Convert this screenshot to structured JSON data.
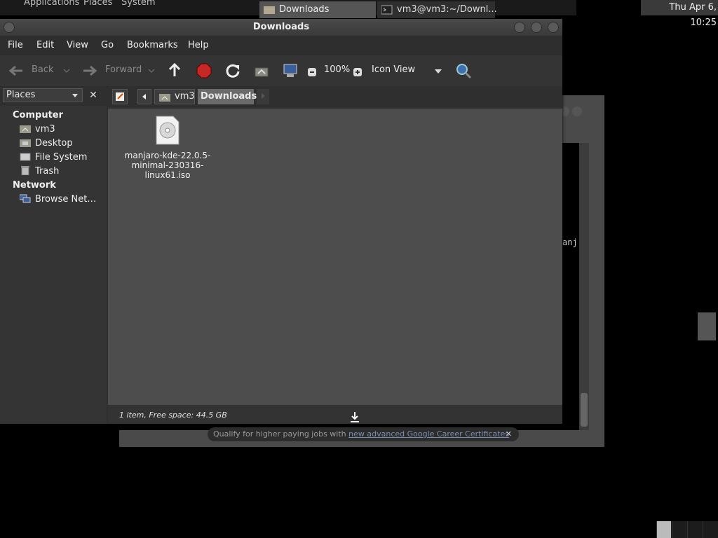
{
  "top_panel": {
    "menus": [
      "Applications",
      "Places",
      "System"
    ],
    "clock": "Thu Apr  6, 10:25"
  },
  "background_terminal": {
    "partial_text": "anj",
    "notification": {
      "text": "Qualify for higher paying jobs with ",
      "link": "new advanced Google Career Certificates",
      "close": "✕"
    }
  },
  "window": {
    "title": "Downloads",
    "menu": [
      "File",
      "Edit",
      "View",
      "Go",
      "Bookmarks",
      "Help"
    ],
    "toolbar": {
      "back": "Back",
      "forward": "Forward",
      "zoom": "100%",
      "view_mode": "Icon View"
    },
    "places": {
      "label": "Places",
      "close": "✕",
      "sections": [
        {
          "title": "Computer",
          "items": [
            {
              "label": "vm3",
              "icon": "home-folder-icon"
            },
            {
              "label": "Desktop",
              "icon": "desktop-folder-icon"
            },
            {
              "label": "File System",
              "icon": "drive-icon"
            },
            {
              "label": "Trash",
              "icon": "trash-icon"
            }
          ]
        },
        {
          "title": "Network",
          "items": [
            {
              "label": "Browse Net…",
              "icon": "network-icon"
            }
          ]
        }
      ]
    },
    "path": {
      "home": "vm3",
      "current": "Downloads"
    },
    "files": [
      {
        "name": "manjaro-kde-22.0.5-minimal-230316-linux61.iso",
        "display_lines": [
          "manjaro-kde-22.0.5-",
          "minimal-230316-",
          "linux61.iso"
        ],
        "icon": "disc-image-icon"
      }
    ],
    "status": "1 item, Free space: 44.5 GB"
  },
  "taskbar": {
    "tasks": [
      {
        "label": "Downloads",
        "icon": "folder-icon",
        "active": true
      },
      {
        "label": "vm3@vm3:~/Downl...",
        "icon": "terminal-icon",
        "active": false
      }
    ]
  }
}
